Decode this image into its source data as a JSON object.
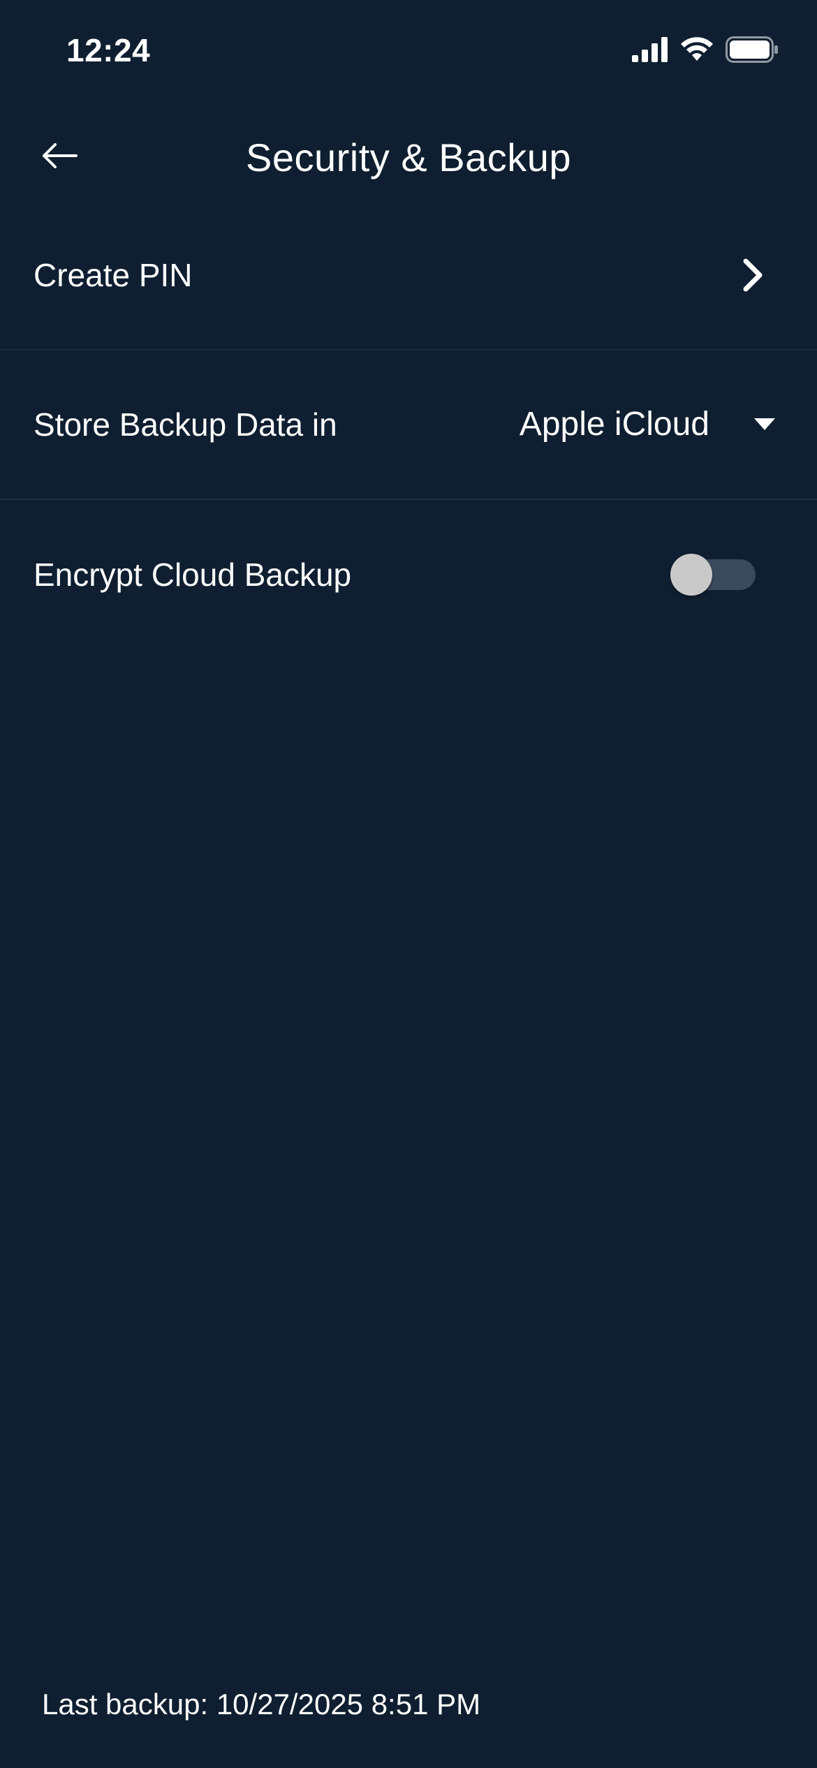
{
  "status_bar": {
    "time": "12:24",
    "icons": [
      "cellular-signal-icon",
      "wifi-icon",
      "battery-icon"
    ]
  },
  "header": {
    "back_icon": "arrow-left-icon",
    "title": "Security & Backup"
  },
  "settings": {
    "create_pin": {
      "label": "Create PIN",
      "icon": "chevron-right-icon"
    },
    "backup_location": {
      "label": "Store Backup Data in",
      "selected_value": "Apple iCloud",
      "icon": "caret-down-icon"
    },
    "encrypt_backup": {
      "label": "Encrypt Cloud Backup",
      "enabled": false
    }
  },
  "footer": {
    "last_backup": "Last backup: 10/27/2025 8:51 PM"
  },
  "colors": {
    "background": "#0f1f31",
    "divider": "#1c2c40",
    "text": "#ffffff",
    "toggle_track_off": "#3a4a5c",
    "toggle_knob_off": "#c9c9c9"
  }
}
